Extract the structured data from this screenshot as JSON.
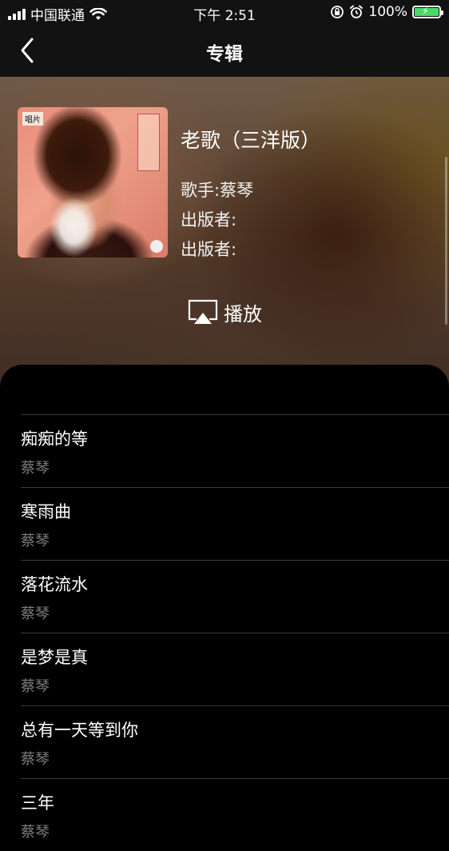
{
  "status_bar": {
    "carrier": "中国联通",
    "time": "下午 2:51",
    "battery": "100%"
  },
  "nav": {
    "title": "专辑"
  },
  "album": {
    "title": "老歌（三洋版）",
    "singer": "歌手:蔡琴",
    "publisher_1": "出版者:",
    "publisher_2": "出版者:",
    "play_label": "播放"
  },
  "songs": [
    {
      "title": "痴痴的等",
      "artist": "蔡琴"
    },
    {
      "title": "寒雨曲",
      "artist": "蔡琴"
    },
    {
      "title": "落花流水",
      "artist": "蔡琴"
    },
    {
      "title": "是梦是真",
      "artist": "蔡琴"
    },
    {
      "title": "总有一天等到你",
      "artist": "蔡琴"
    },
    {
      "title": "三年",
      "artist": "蔡琴"
    }
  ],
  "colors": {
    "battery_fill": "#4cd964",
    "artist_text": "#7d7d7d",
    "divider": "#3a3a3a"
  }
}
